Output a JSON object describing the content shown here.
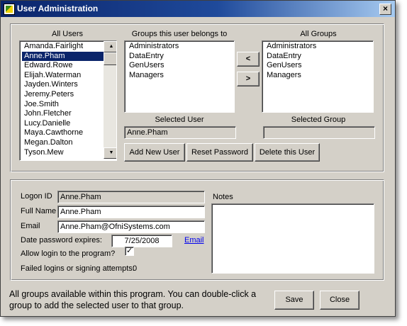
{
  "window": {
    "title": "User Administration",
    "close_glyph": "×",
    "icon": "app-logo-icon"
  },
  "users_panel": {
    "all_users_label": "All Users",
    "users": [
      "Amanda.Fairlight",
      "Anne.Pham",
      "Edward.Rowe",
      "Elijah.Waterman",
      "Jayden.Winters",
      "Jeremy.Peters",
      "Joe.Smith",
      "John.Fletcher",
      "Lucy.Danielle",
      "Maya.Cawthorne",
      "Megan.Dalton",
      "Tyson.Mew"
    ],
    "selected_user_index": 1,
    "groups_label": "Groups this user belongs to",
    "user_groups": [
      "Administrators",
      "DataEntry",
      "GenUsers",
      "Managers"
    ],
    "all_groups_label": "All Groups",
    "all_groups": [
      "Administrators",
      "DataEntry",
      "GenUsers",
      "Managers"
    ],
    "move_left_label": "<",
    "move_right_label": ">",
    "selected_user_label": "Selected User",
    "selected_user_value": "Anne.Pham",
    "selected_group_label": "Selected Group",
    "selected_group_value": "",
    "add_user_label": "Add New User",
    "reset_password_label": "Reset Password",
    "delete_user_label": "Delete this User"
  },
  "details": {
    "logon_id_label": "Logon ID",
    "logon_id_value": "Anne.Pham",
    "full_name_label": "Full Name",
    "full_name_value": "Anne.Pham",
    "email_label": "Email",
    "email_value": "Anne.Pham@OfniSystems.com",
    "date_expires_label": "Date password expires:",
    "date_expires_value": "7/25/2008",
    "email_link_label": "Email",
    "allow_login_label": "Allow login to the program?",
    "allow_login_checked": true,
    "check_glyph": "✓",
    "failed_logins_label": "Failed logins or signing attempts:",
    "failed_logins_value": "0",
    "notes_label": "Notes",
    "notes_value": ""
  },
  "footer": {
    "message": "All groups available within this program.  You can double-click a group to add the selected user to that group.",
    "save_label": "Save",
    "close_label": "Close"
  },
  "colors": {
    "title_start": "#0a246a",
    "title_end": "#a6caf0",
    "face": "#d4d0c8",
    "selection": "#0a246a",
    "link": "#0000ee"
  }
}
